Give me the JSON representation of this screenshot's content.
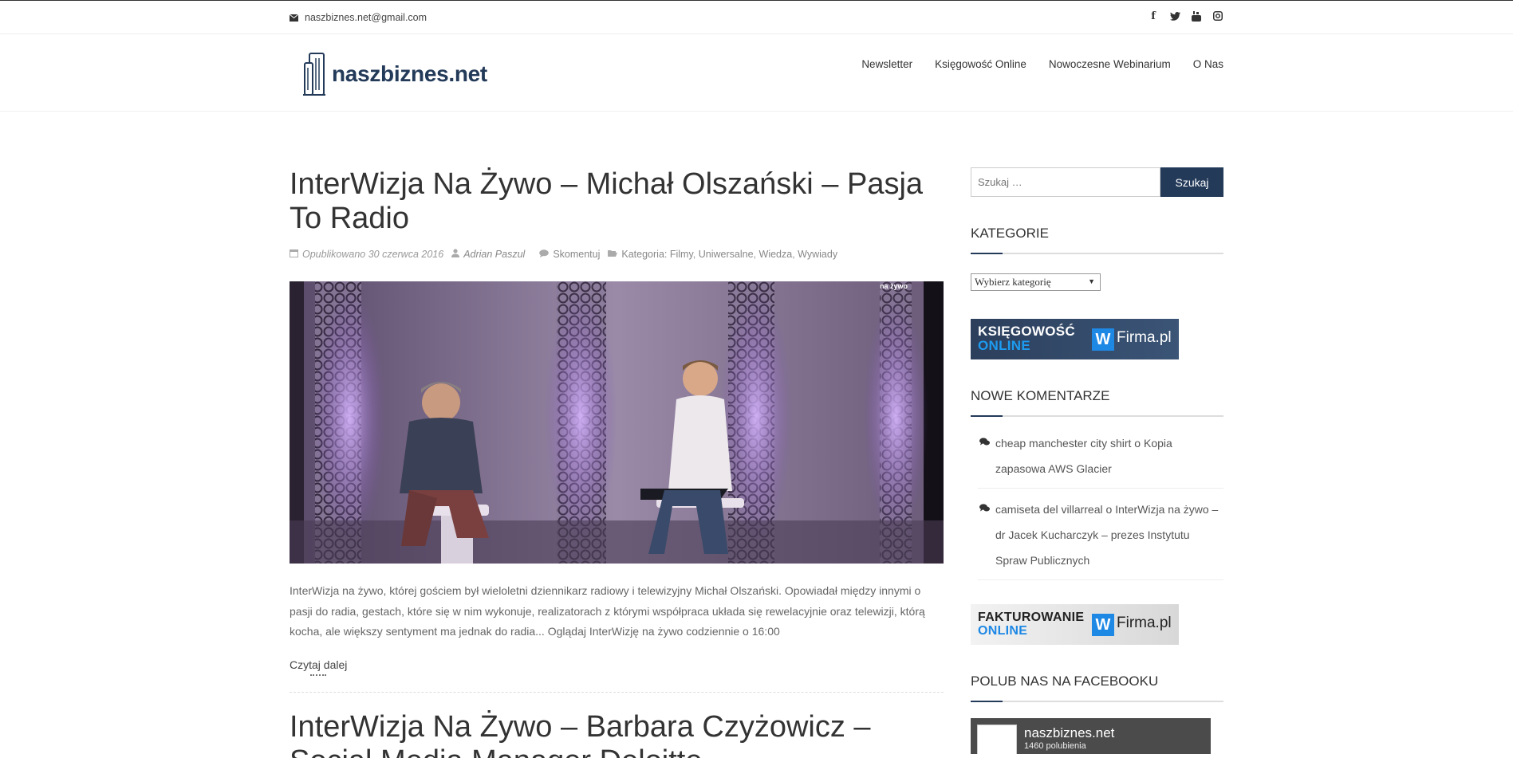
{
  "topbar": {
    "email": "naszbiznes.net@gmail.com",
    "social_icons": [
      "facebook-icon",
      "twitter-icon",
      "youtube-icon",
      "instagram-icon"
    ]
  },
  "header": {
    "logo_text": "naszbiznes.net",
    "nav": [
      "Newsletter",
      "Księgowość Online",
      "Nowoczesne Webinarium",
      "O Nas"
    ]
  },
  "colors": {
    "brand": "#233a59",
    "accent_blue": "#1e88e5"
  },
  "posts": [
    {
      "title": "InterWizja Na Żywo – Michał Olszański – Pasja To Radio",
      "meta": {
        "published": "Opublikowano 30 czerwca 2016",
        "author": "Adrian Paszul",
        "comments": "Skomentuj",
        "category_label": "Kategoria:",
        "categories": [
          "Filmy",
          "Uniwersalne",
          "Wiedza",
          "Wywiady"
        ],
        "separator": ","
      },
      "image_watermark": "na żywo",
      "excerpt": "InterWizja na żywo, której gościem był wieloletni dziennikarz radiowy i telewizyjny Michał Olszański. Opowiadał między innymi o pasji do radia, gestach, które się w nim wykonuje, realizatorach z którymi współpraca układa się rewelacyjnie oraz telewizji, którą kocha, ale większy sentyment ma jednak do radia... Oglądaj InterWizję na żywo codziennie o 16:00",
      "read_more": "Czytaj dalej"
    },
    {
      "title": "InterWizja Na Żywo – Barbara Czyżowicz – Social Media Manager Deloitte"
    }
  ],
  "sidebar": {
    "search": {
      "placeholder": "Szukaj …",
      "button": "Szukaj"
    },
    "categories": {
      "title": "KATEGORIE",
      "select_value": "Wybierz kategorię"
    },
    "banner1": {
      "line1": "KSIĘGOWOŚĆ",
      "line2": "ONLINE",
      "w": "W",
      "brand": "Firma.pl"
    },
    "comments": {
      "title": "NOWE KOMENTARZE",
      "items": [
        {
          "author": "cheap manchester city shirt",
          "connector": "o",
          "post": "Kopia zapasowa AWS Glacier"
        },
        {
          "author": "camiseta del villarreal",
          "connector": "o",
          "post": "InterWizja na żywo – dr Jacek Kucharczyk – prezes Instytutu Spraw Publicznych"
        }
      ]
    },
    "banner2": {
      "line1": "FAKTUROWANIE",
      "line2": "ONLINE",
      "w": "W",
      "brand": "Firma.pl"
    },
    "facebook": {
      "title": "POLUB NAS NA FACEBOOKU",
      "page_name": "naszbiznes.net",
      "likes": "1460 polubienia"
    }
  }
}
